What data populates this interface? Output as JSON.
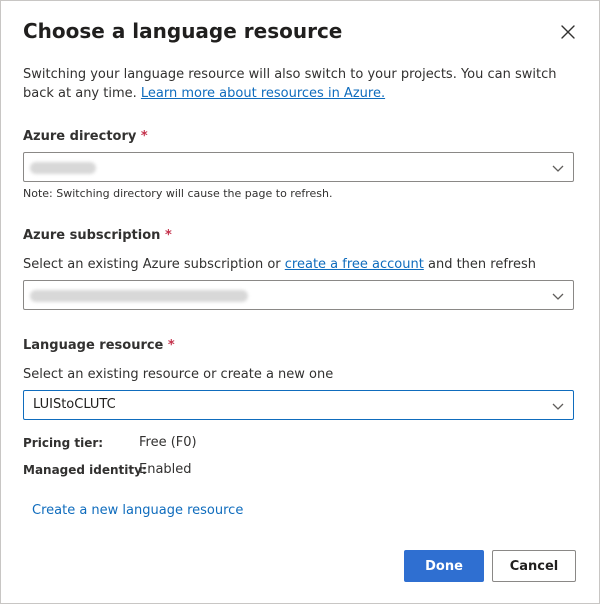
{
  "dialog": {
    "title": "Choose a language resource",
    "intro_text": "Switching your language resource will also switch to your projects. You can switch back at any time.",
    "intro_link": "Learn more about resources in Azure."
  },
  "directory": {
    "label": "Azure directory",
    "required_mark": "*",
    "note": "Note: Switching directory will cause the page to refresh."
  },
  "subscription": {
    "label": "Azure subscription",
    "required_mark": "*",
    "helper_prefix": "Select an existing Azure subscription or",
    "helper_link": "create a free account",
    "helper_suffix": "and then refresh"
  },
  "resource": {
    "label": "Language resource",
    "required_mark": "*",
    "helper": "Select an existing resource or create a new one",
    "selected_value": "LUIStoCLUTC"
  },
  "details": {
    "pricing_label": "Pricing tier:",
    "pricing_value": "Free (F0)",
    "identity_label": "Managed identity:",
    "identity_value": "Enabled"
  },
  "create_link": "Create a new language resource",
  "buttons": {
    "done": "Done",
    "cancel": "Cancel"
  },
  "colors": {
    "primary": "#2f6fd1",
    "link": "#0f6cbd",
    "required": "#c4314b"
  },
  "icons": {
    "close": "close-icon",
    "chevron": "chevron-down-icon"
  }
}
